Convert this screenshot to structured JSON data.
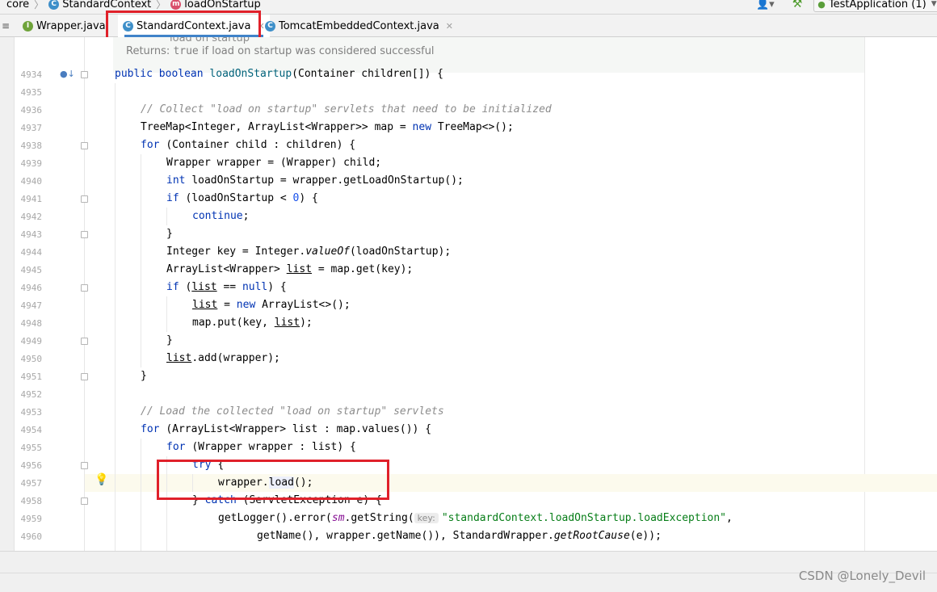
{
  "breadcrumb": {
    "items": [
      "core",
      "StandardContext",
      "loadOnStartup"
    ]
  },
  "run_config": {
    "label": "TestApplication (1)"
  },
  "tabs": [
    {
      "label": "Wrapper.java",
      "icon": "I"
    },
    {
      "label": "StandardContext.java",
      "icon": "C"
    },
    {
      "label": "TomcatEmbeddedContext.java",
      "icon": "C"
    }
  ],
  "doc": {
    "partial_top": "load on startup",
    "returns_label": "Returns:",
    "returns_code": "true",
    "returns_text": " if load on startup was considered successful"
  },
  "line_numbers": [
    "4934",
    "4935",
    "4936",
    "4937",
    "4938",
    "4939",
    "4940",
    "4941",
    "4942",
    "4943",
    "4944",
    "4945",
    "4946",
    "4947",
    "4948",
    "4949",
    "4950",
    "4951",
    "4952",
    "4953",
    "4954",
    "4955",
    "4956",
    "4957",
    "4958",
    "4959",
    "4960"
  ],
  "code": {
    "l4934": [
      "public ",
      "boolean ",
      "loadOnStartup",
      "(Container children[]) {"
    ],
    "l4936": "// Collect \"load on startup\" servlets that need to be initialized",
    "l4937": [
      "TreeMap<Integer, ArrayList<Wrapper>> map = ",
      "new ",
      "TreeMap<>();"
    ],
    "l4938": [
      "for ",
      "(Container child : children) {"
    ],
    "l4939": "Wrapper wrapper = (Wrapper) child;",
    "l4940": [
      "int ",
      "loadOnStartup = wrapper.getLoadOnStartup();"
    ],
    "l4941": [
      "if ",
      "(loadOnStartup < ",
      "0",
      ") {"
    ],
    "l4942": [
      "continue",
      ";"
    ],
    "l4943": "}",
    "l4944": [
      "Integer key = Integer.",
      "valueOf",
      "(loadOnStartup);"
    ],
    "l4945": [
      "ArrayList<Wrapper> ",
      "list",
      " = map.get(key);"
    ],
    "l4946": [
      "if ",
      "(",
      "list",
      " == ",
      "null",
      ") {"
    ],
    "l4947": [
      "list",
      " = ",
      "new ",
      "ArrayList<>();"
    ],
    "l4948": [
      "map.put(key, ",
      "list",
      ");"
    ],
    "l4949": "}",
    "l4950": [
      "list",
      ".add(wrapper);"
    ],
    "l4951": "}",
    "l4953": "// Load the collected \"load on startup\" servlets",
    "l4954": [
      "for ",
      "(ArrayList<Wrapper> list : map.values()) {"
    ],
    "l4955": [
      "for ",
      "(Wrapper wrapper : list) {"
    ],
    "l4956": [
      "try ",
      "{"
    ],
    "l4957": [
      "wrapper.",
      "load",
      "();"
    ],
    "l4958": [
      "} ",
      "catch ",
      "(ServletException e) {"
    ],
    "l4959": [
      "getLogger().error(",
      "sm",
      ".getString(",
      "key:",
      "\"standardContext.loadOnStartup.loadException\"",
      ","
    ],
    "l4960": [
      "getName(), wrapper.getName()), StandardWrapper.",
      "getRootCause",
      "(e));"
    ]
  },
  "watermark": "CSDN @Lonely_Devil",
  "colors": {
    "keyword": "#0033b3",
    "comment": "#8c8c8c",
    "number": "#1750eb",
    "string": "#067d17",
    "highlight_box": "#e0202a",
    "tab_underline": "#4083c9"
  }
}
